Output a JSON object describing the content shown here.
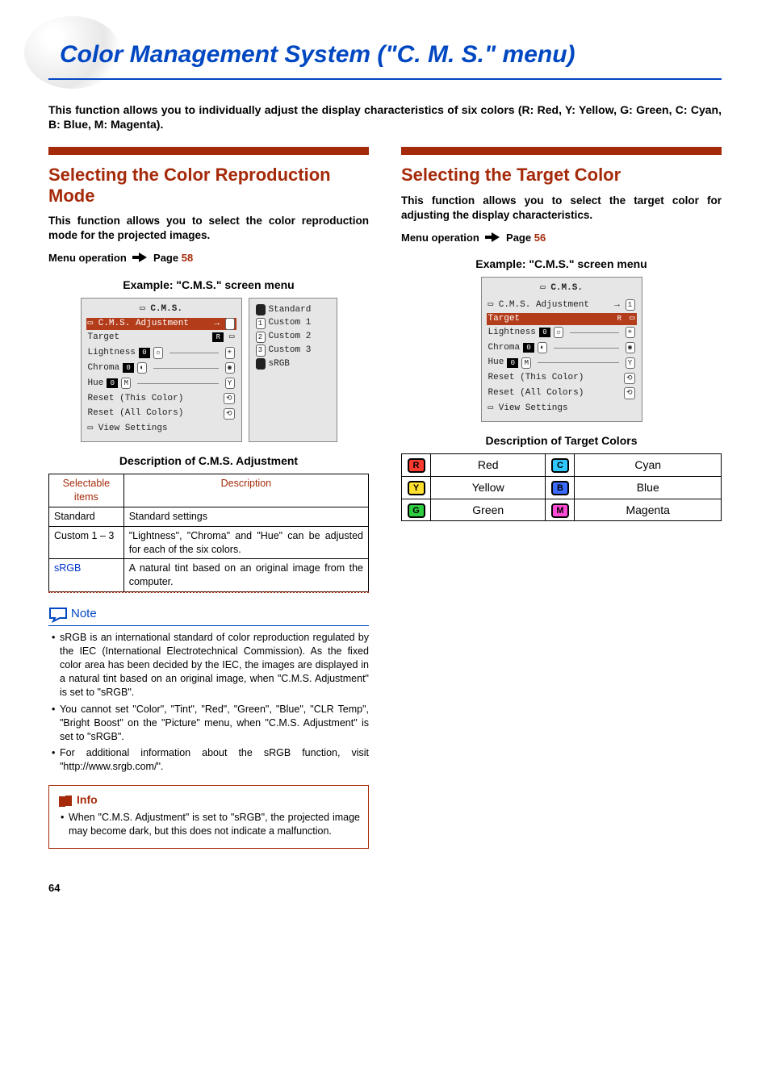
{
  "page_title": "Color Management System (\"C. M. S.\" menu)",
  "intro": "This function allows you to individually adjust the display characteristics of six colors (R: Red, Y: Yellow, G: Green, C: Cyan, B: Blue, M: Magenta).",
  "left": {
    "heading": "Selecting the Color Reproduction Mode",
    "desc": "This function allows you to select the color reproduction mode for the projected images.",
    "menu_op_label": "Menu operation",
    "menu_op_page_label": "Page",
    "menu_op_page": "58",
    "example_label": "Example: \"C.M.S.\" screen menu",
    "osd": {
      "title": "C.M.S.",
      "adjustment": "C.M.S. Adjustment",
      "adjustment_badge": "1",
      "target": "Target",
      "target_badge": "R",
      "lightness": "Lightness",
      "lightness_val": "0",
      "chroma": "Chroma",
      "chroma_val": "0",
      "hue": "Hue",
      "hue_val": "0",
      "hue_badge": "M",
      "hue_end": "Y",
      "reset_this": "Reset (This Color)",
      "reset_all": "Reset (All Colors)",
      "view": "View Settings"
    },
    "osd_options": {
      "standard": "Standard",
      "c1": "Custom 1",
      "c2": "Custom 2",
      "c3": "Custom 3",
      "srgb": "sRGB"
    },
    "adj_table_title": "Description of C.M.S. Adjustment",
    "adj_table": {
      "h1": "Selectable items",
      "h2": "Description",
      "r1c1": "Standard",
      "r1c2": "Standard settings",
      "r2c1": "Custom 1 – 3",
      "r2c2": "\"Lightness\", \"Chroma\" and \"Hue\" can be adjusted for each of the six colors.",
      "r3c1": "sRGB",
      "r3c2": "A natural tint based on an original image from the computer."
    },
    "note_label": "Note",
    "notes": [
      "sRGB is an international standard of color reproduction regulated by the IEC (International Electrotechnical Commission). As the fixed color area has been decided by the IEC, the images are displayed in a natural tint based on an original image, when \"C.M.S. Adjustment\" is set to \"sRGB\".",
      "You cannot set \"Color\", \"Tint\", \"Red\", \"Green\", \"Blue\", \"CLR Temp\", \"Bright Boost\" on the \"Picture\" menu, when \"C.M.S. Adjustment\" is set to \"sRGB\".",
      "For additional information about the sRGB function, visit \"http://www.srgb.com/\"."
    ],
    "info_label": "Info",
    "info_text": "When \"C.M.S. Adjustment\" is set to \"sRGB\", the projected image may become dark, but this does not indicate a malfunction."
  },
  "right": {
    "heading": "Selecting the Target Color",
    "desc": "This function allows you to select the target color for adjusting the display characteristics.",
    "menu_op_label": "Menu operation",
    "menu_op_page_label": "Page",
    "menu_op_page": "56",
    "example_label": "Example: \"C.M.S.\" screen menu",
    "osd": {
      "title": "C.M.S.",
      "adjustment": "C.M.S. Adjustment",
      "adjustment_badge": "1",
      "target": "Target",
      "target_badge": "R",
      "lightness": "Lightness",
      "lightness_val": "0",
      "chroma": "Chroma",
      "chroma_val": "0",
      "hue": "Hue",
      "hue_val": "0",
      "hue_badge": "M",
      "hue_end": "Y",
      "reset_this": "Reset (This Color)",
      "reset_all": "Reset (All Colors)",
      "view": "View Settings"
    },
    "target_table_title": "Description of Target Colors",
    "target_table": [
      {
        "chip": "R",
        "color": "#ff3b30",
        "label": "Red"
      },
      {
        "chip": "C",
        "color": "#2ec8ff",
        "label": "Cyan"
      },
      {
        "chip": "Y",
        "color": "#ffe02e",
        "label": "Yellow"
      },
      {
        "chip": "B",
        "color": "#3b6bff",
        "label": "Blue"
      },
      {
        "chip": "G",
        "color": "#2ecc40",
        "label": "Green"
      },
      {
        "chip": "M",
        "color": "#ff4bd6",
        "label": "Magenta"
      }
    ]
  },
  "page_number": "64"
}
